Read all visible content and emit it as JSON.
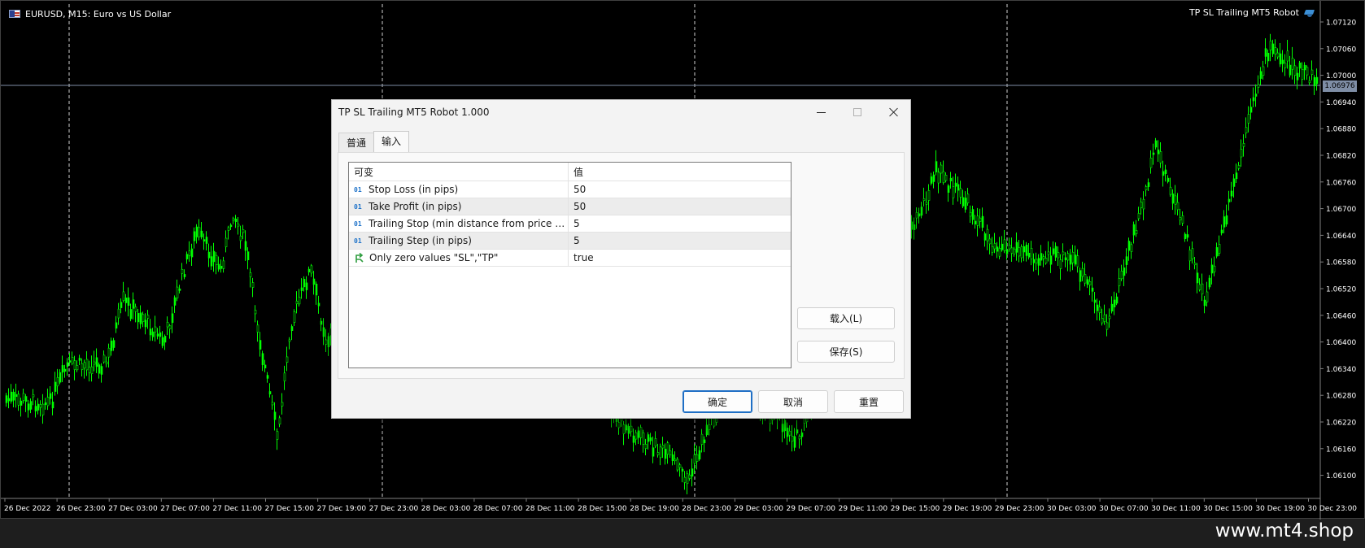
{
  "chart": {
    "symbol_title": "EURUSD, M15:  Euro vs US Dollar",
    "ea_name": "TP SL Trailing MT5 Robot",
    "current_price": "1.06976",
    "price_axis": [
      "1.07120",
      "1.07060",
      "1.07000",
      "1.06940",
      "1.06880",
      "1.06820",
      "1.06760",
      "1.06700",
      "1.06640",
      "1.06580",
      "1.06520",
      "1.06460",
      "1.06400",
      "1.06340",
      "1.06280",
      "1.06220",
      "1.06160",
      "1.06100"
    ],
    "time_axis": [
      "26 Dec 2022",
      "26 Dec 23:00",
      "27 Dec 03:00",
      "27 Dec 07:00",
      "27 Dec 11:00",
      "27 Dec 15:00",
      "27 Dec 19:00",
      "27 Dec 23:00",
      "28 Dec 03:00",
      "28 Dec 07:00",
      "28 Dec 11:00",
      "28 Dec 15:00",
      "28 Dec 19:00",
      "28 Dec 23:00",
      "29 Dec 03:00",
      "29 Dec 07:00",
      "29 Dec 11:00",
      "29 Dec 15:00",
      "29 Dec 19:00",
      "29 Dec 23:00",
      "30 Dec 03:00",
      "30 Dec 07:00",
      "30 Dec 11:00",
      "30 Dec 15:00",
      "30 Dec 19:00",
      "30 Dec 23:00"
    ],
    "candle_color": "#00ff00",
    "background": "#000000"
  },
  "watermark": "www.mt4.shop",
  "dialog": {
    "title": "TP SL Trailing MT5 Robot 1.000",
    "tabs": [
      {
        "label": "普通",
        "active": false
      },
      {
        "label": "输入",
        "active": true
      }
    ],
    "grid": {
      "headers": [
        "可变",
        "值"
      ],
      "rows": [
        {
          "type": "int",
          "type_label": "01",
          "name": "Stop Loss (in pips)",
          "value": "50"
        },
        {
          "type": "int",
          "type_label": "01",
          "name": "Take Profit (in pips)",
          "value": "50"
        },
        {
          "type": "int",
          "type_label": "01",
          "name": "Trailing Stop (min distance from price to Stop Loss, in pips)",
          "value": "5"
        },
        {
          "type": "int",
          "type_label": "01",
          "name": "Trailing Step (in pips)",
          "value": "5"
        },
        {
          "type": "bool",
          "type_label": "",
          "name": "Only zero values \"SL\",\"TP\"",
          "value": "true"
        }
      ]
    },
    "load_button": "载入(L)",
    "save_button": "保存(S)",
    "ok_button": "确定",
    "cancel_button": "取消",
    "reset_button": "重置"
  }
}
